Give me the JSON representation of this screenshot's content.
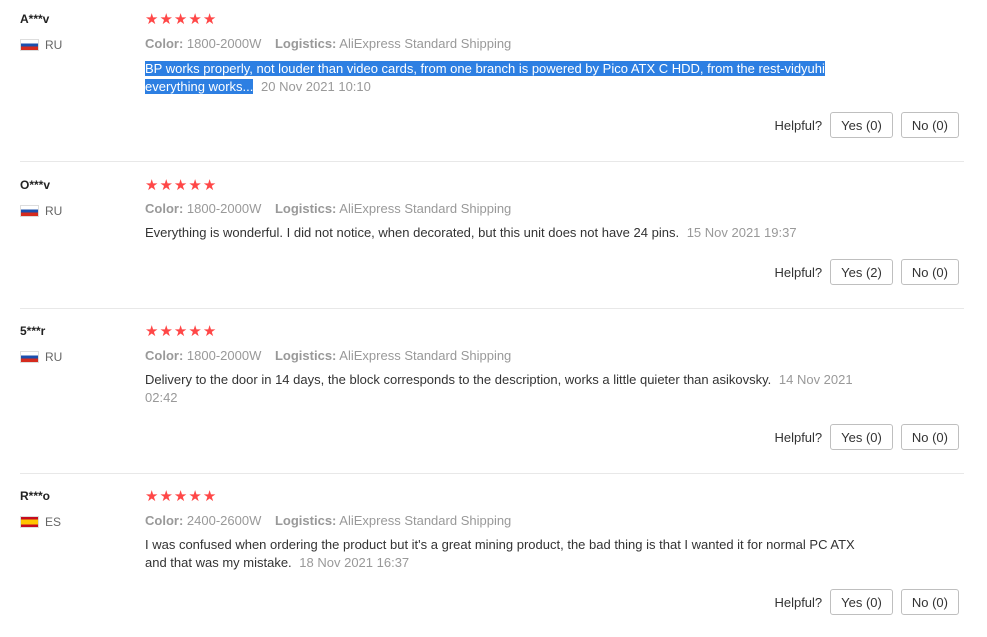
{
  "helpful_label": "Helpful?",
  "colors": {
    "star": "#ff4747",
    "selection": "#2d7fe2"
  },
  "reviews": [
    {
      "user": "A***v",
      "country": "RU",
      "flag_icon": "russia-flag-icon",
      "rating": 5,
      "color_label": "Color:",
      "color_value": "1800-2000W",
      "logistics_label": "Logistics:",
      "logistics_value": "AliExpress Standard Shipping",
      "text_line1": "BP works properly, not louder than video cards, from one branch is powered by Pico ATX C HDD, from the rest-vidyuhi",
      "text_line2": "everything works...",
      "date": "20 Nov 2021 10:10",
      "yes_label": "Yes (0)",
      "no_label": "No (0)"
    },
    {
      "user": "O***v",
      "country": "RU",
      "flag_icon": "russia-flag-icon",
      "rating": 5,
      "color_label": "Color:",
      "color_value": "1800-2000W",
      "logistics_label": "Logistics:",
      "logistics_value": "AliExpress Standard Shipping",
      "text": "Everything is wonderful. I did not notice, when decorated, but this unit does not have 24 pins.",
      "date": "15 Nov 2021 19:37",
      "yes_label": "Yes (2)",
      "no_label": "No (0)"
    },
    {
      "user": "5***r",
      "country": "RU",
      "flag_icon": "russia-flag-icon",
      "rating": 5,
      "color_label": "Color:",
      "color_value": "1800-2000W",
      "logistics_label": "Logistics:",
      "logistics_value": "AliExpress Standard Shipping",
      "text": "Delivery to the door in 14 days, the block corresponds to the description, works a little quieter than asikovsky.",
      "date": "14 Nov 2021 02:42",
      "yes_label": "Yes (0)",
      "no_label": "No (0)"
    },
    {
      "user": "R***o",
      "country": "ES",
      "flag_icon": "spain-flag-icon",
      "rating": 5,
      "color_label": "Color:",
      "color_value": "2400-2600W",
      "logistics_label": "Logistics:",
      "logistics_value": "AliExpress Standard Shipping",
      "text": "I was confused when ordering the product but it's a great mining product, the bad thing is that I wanted it for normal PC ATX and that was my mistake.",
      "date": "18 Nov 2021 16:37",
      "yes_label": "Yes (0)",
      "no_label": "No (0)"
    }
  ]
}
